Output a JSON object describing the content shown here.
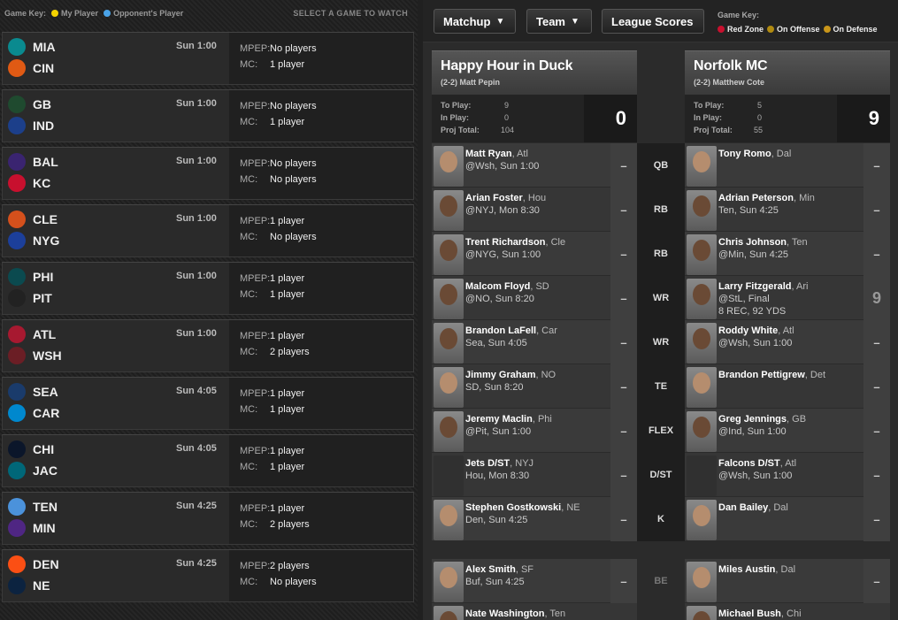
{
  "left_key": {
    "label": "Game Key:",
    "my_player": "My Player",
    "my_player_color": "#f5d300",
    "opp_player": "Opponent's Player",
    "opp_player_color": "#4aa3e8",
    "select_text": "SELECT A GAME TO WATCH"
  },
  "games": [
    {
      "team1": "MIA",
      "team2": "CIN",
      "time": "Sun 1:00",
      "mpep": "No players",
      "mc": "1 player",
      "c1": "#0a8a8f",
      "c2": "#e05a14"
    },
    {
      "team1": "GB",
      "team2": "IND",
      "time": "Sun 1:00",
      "mpep": "No players",
      "mc": "1 player",
      "c1": "#1f4a2f",
      "c2": "#1c3f8a"
    },
    {
      "team1": "BAL",
      "team2": "KC",
      "time": "Sun 1:00",
      "mpep": "No players",
      "mc": "No players",
      "c1": "#3a2470",
      "c2": "#c8102e"
    },
    {
      "team1": "CLE",
      "team2": "NYG",
      "time": "Sun 1:00",
      "mpep": "1 player",
      "mc": "No players",
      "c1": "#d4501c",
      "c2": "#1c3f9a"
    },
    {
      "team1": "PHI",
      "team2": "PIT",
      "time": "Sun 1:00",
      "mpep": "1 player",
      "mc": "1 player",
      "c1": "#0b4a4f",
      "c2": "#222222"
    },
    {
      "team1": "ATL",
      "team2": "WSH",
      "time": "Sun 1:00",
      "mpep": "1 player",
      "mc": "2 players",
      "c1": "#a71930",
      "c2": "#6b1e25"
    },
    {
      "team1": "SEA",
      "team2": "CAR",
      "time": "Sun 4:05",
      "mpep": "1 player",
      "mc": "1 player",
      "c1": "#1a3b6b",
      "c2": "#0088ce"
    },
    {
      "team1": "CHI",
      "team2": "JAC",
      "time": "Sun 4:05",
      "mpep": "1 player",
      "mc": "1 player",
      "c1": "#0b162a",
      "c2": "#006778"
    },
    {
      "team1": "TEN",
      "team2": "MIN",
      "time": "Sun 4:25",
      "mpep": "1 player",
      "mc": "2 players",
      "c1": "#4b92db",
      "c2": "#4f2683"
    },
    {
      "team1": "DEN",
      "team2": "NE",
      "time": "Sun 4:25",
      "mpep": "2 players",
      "mc": "No players",
      "c1": "#fb4f14",
      "c2": "#0c2340"
    }
  ],
  "mpep_label": "MPEP:",
  "mc_label": "MC:",
  "topbar": {
    "matchup": "Matchup",
    "team": "Team",
    "league_scores": "League Scores",
    "key_label": "Game Key:",
    "red_zone": "Red Zone",
    "red_zone_color": "#c8102e",
    "on_offense": "On Offense",
    "on_offense_color": "#b08a10",
    "on_defense": "On Defense",
    "on_defense_color": "#c9961a"
  },
  "team_left": {
    "name": "Happy Hour in Duck",
    "record": "(2-2)",
    "owner": "Matt Pepin",
    "to_play_label": "To Play:",
    "to_play": "9",
    "in_play_label": "In Play:",
    "in_play": "0",
    "proj_label": "Proj Total:",
    "proj": "104",
    "score": "0"
  },
  "team_right": {
    "name": "Norfolk MC",
    "record": "(2-2)",
    "owner": "Matthew Cote",
    "to_play_label": "To Play:",
    "to_play": "5",
    "in_play_label": "In Play:",
    "in_play": "0",
    "proj_label": "Proj Total:",
    "proj": "55",
    "score": "9"
  },
  "slots": [
    {
      "pos": "QB",
      "l_name": "Matt Ryan",
      "l_team": ", Atl",
      "l_line": "@Wsh, Sun 1:00",
      "l_pts": "–",
      "r_name": "Tony Romo",
      "r_team": ", Dal",
      "r_line": "",
      "r_line2": "",
      "r_pts": "–"
    },
    {
      "pos": "RB",
      "l_name": "Arian Foster",
      "l_team": ", Hou",
      "l_line": "@NYJ, Mon 8:30",
      "l_pts": "–",
      "r_name": "Adrian Peterson",
      "r_team": ", Min",
      "r_line": "Ten, Sun 4:25",
      "r_line2": "",
      "r_pts": "–"
    },
    {
      "pos": "RB",
      "l_name": "Trent Richardson",
      "l_team": ", Cle",
      "l_line": "@NYG, Sun 1:00",
      "l_pts": "–",
      "r_name": "Chris Johnson",
      "r_team": ", Ten",
      "r_line": "@Min, Sun 4:25",
      "r_line2": "",
      "r_pts": "–"
    },
    {
      "pos": "WR",
      "l_name": "Malcom Floyd",
      "l_team": ", SD",
      "l_line": "@NO, Sun 8:20",
      "l_pts": "–",
      "r_name": "Larry Fitzgerald",
      "r_team": ", Ari",
      "r_line": "@StL, Final",
      "r_line2": "8 REC, 92 YDS",
      "r_pts": "9"
    },
    {
      "pos": "WR",
      "l_name": "Brandon LaFell",
      "l_team": ", Car",
      "l_line": "Sea, Sun 4:05",
      "l_pts": "–",
      "r_name": "Roddy White",
      "r_team": ", Atl",
      "r_line": "@Wsh, Sun 1:00",
      "r_line2": "",
      "r_pts": "–"
    },
    {
      "pos": "TE",
      "l_name": "Jimmy Graham",
      "l_team": ", NO",
      "l_line": "SD, Sun 8:20",
      "l_pts": "–",
      "r_name": "Brandon Pettigrew",
      "r_team": ", Det",
      "r_line": "",
      "r_line2": "",
      "r_pts": "–"
    },
    {
      "pos": "FLEX",
      "l_name": "Jeremy Maclin",
      "l_team": ", Phi",
      "l_line": "@Pit, Sun 1:00",
      "l_pts": "–",
      "r_name": "Greg Jennings",
      "r_team": ", GB",
      "r_line": "@Ind, Sun 1:00",
      "r_line2": "",
      "r_pts": "–"
    },
    {
      "pos": "D/ST",
      "l_name": "Jets D/ST",
      "l_team": ", NYJ",
      "l_line": "Hou, Mon 8:30",
      "l_pts": "–",
      "r_name": "Falcons D/ST",
      "r_team": ", Atl",
      "r_line": "@Wsh, Sun 1:00",
      "r_line2": "",
      "r_pts": "–"
    },
    {
      "pos": "K",
      "l_name": "Stephen Gostkowski",
      "l_team": ", NE",
      "l_line": "Den, Sun 4:25",
      "l_pts": "–",
      "r_name": "Dan Bailey",
      "r_team": ", Dal",
      "r_line": "",
      "r_line2": "",
      "r_pts": "–"
    }
  ],
  "bench": [
    {
      "pos": "BE",
      "l_name": "Alex Smith",
      "l_team": ", SF",
      "l_line": "Buf, Sun 4:25",
      "l_pts": "–",
      "r_name": "Miles Austin",
      "r_team": ", Dal",
      "r_line": "",
      "r_pts": "–"
    },
    {
      "pos": "",
      "l_name": "Nate Washington",
      "l_team": ", Ten",
      "l_line": "",
      "l_pts": "",
      "r_name": "Michael Bush",
      "r_team": ", Chi",
      "r_line": "",
      "r_pts": ""
    }
  ]
}
